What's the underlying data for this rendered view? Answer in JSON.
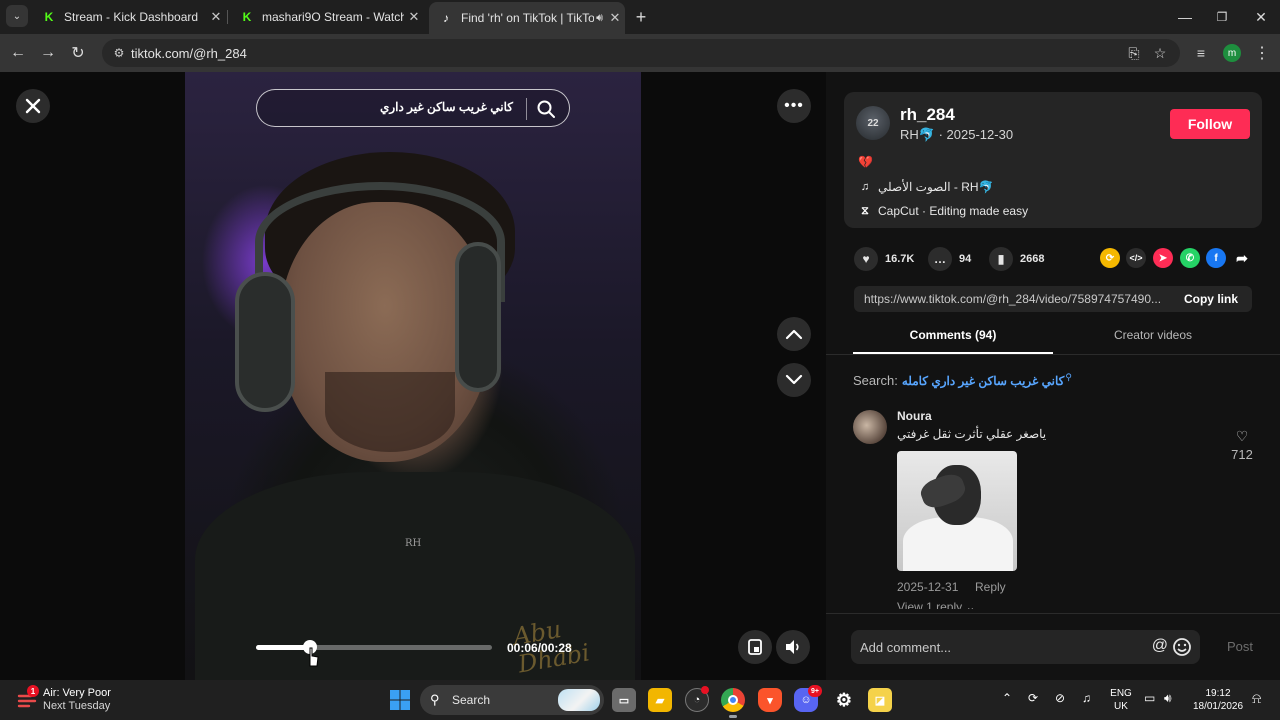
{
  "browser": {
    "tabs": [
      {
        "title": "Stream - Kick Dashboard",
        "favicon": "kick-logo",
        "active": false
      },
      {
        "title": "mashari9O Stream - Watch Live",
        "favicon": "kick-logo",
        "active": false
      },
      {
        "title": "Find 'rh' on TikTok | TikTok S",
        "favicon": "tiktok-logo",
        "active": true
      }
    ],
    "url": "tiktok.com/@rh_284",
    "profile_initial": "m"
  },
  "player": {
    "search_query": "كاني غريب ساكن غير داري",
    "watermark": "RH",
    "caption_script": "Abu Dhabi",
    "time": "00:06/00:28",
    "progress": 0.23
  },
  "post": {
    "avatar_text": "22",
    "username": "rh_284",
    "nickname": "RH🐬",
    "date": "2025-12-30",
    "follow_label": "Follow",
    "description": "💔",
    "music": "الصوت الأصلي - RH🐬",
    "capcut": "CapCut · Editing made easy",
    "likes": "16.7K",
    "comments": "94",
    "saves": "2668",
    "link": "https://www.tiktok.com/@rh_284/video/758974757490...",
    "copy_label": "Copy link"
  },
  "tabs": {
    "comments": "Comments (94)",
    "creator": "Creator videos"
  },
  "search": {
    "label": "Search:",
    "term": "كاني غريب ساكن غير داري كامله"
  },
  "comment": {
    "name": "Noura",
    "text": "ياصغر عقلي تأثرت ثقل غرفتي",
    "likes": "712",
    "date": "2025-12-31",
    "reply": "Reply",
    "view_replies": "View 1 reply"
  },
  "compose": {
    "placeholder": "Add comment...",
    "post": "Post"
  },
  "taskbar": {
    "weather_badge": "1",
    "weather_line1": "Air: Very Poor",
    "weather_line2": "Next Tuesday",
    "search_label": "Search",
    "discord_badge": "9+",
    "lang_line1": "ENG",
    "lang_line2": "UK",
    "time": "19:12",
    "date": "18/01/2026"
  },
  "colors": {
    "follow": "#fe2c55",
    "search_term": "#58a6ff"
  }
}
